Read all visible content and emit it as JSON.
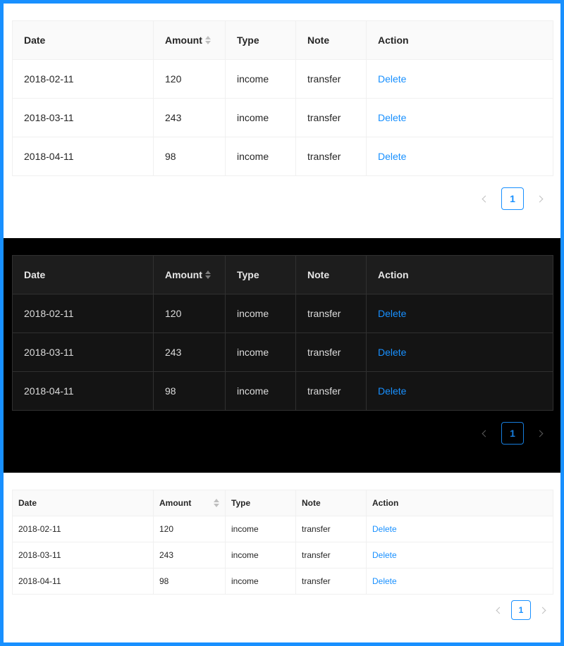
{
  "columns": {
    "date": "Date",
    "amount": "Amount",
    "type": "Type",
    "note": "Note",
    "action": "Action"
  },
  "rows": [
    {
      "date": "2018-02-11",
      "amount": "120",
      "type": "income",
      "note": "transfer",
      "action": "Delete"
    },
    {
      "date": "2018-03-11",
      "amount": "243",
      "type": "income",
      "note": "transfer",
      "action": "Delete"
    },
    {
      "date": "2018-04-11",
      "amount": "98",
      "type": "income",
      "note": "transfer",
      "action": "Delete"
    }
  ],
  "pagination": {
    "current_page": "1"
  },
  "colors": {
    "accent": "#1890ff",
    "dark_bg": "#000000",
    "dark_row": "#141414",
    "dark_header": "#1d1d1d"
  },
  "icons": {
    "sort": "sort-icon",
    "prev": "chevron-left-icon",
    "next": "chevron-right-icon"
  }
}
